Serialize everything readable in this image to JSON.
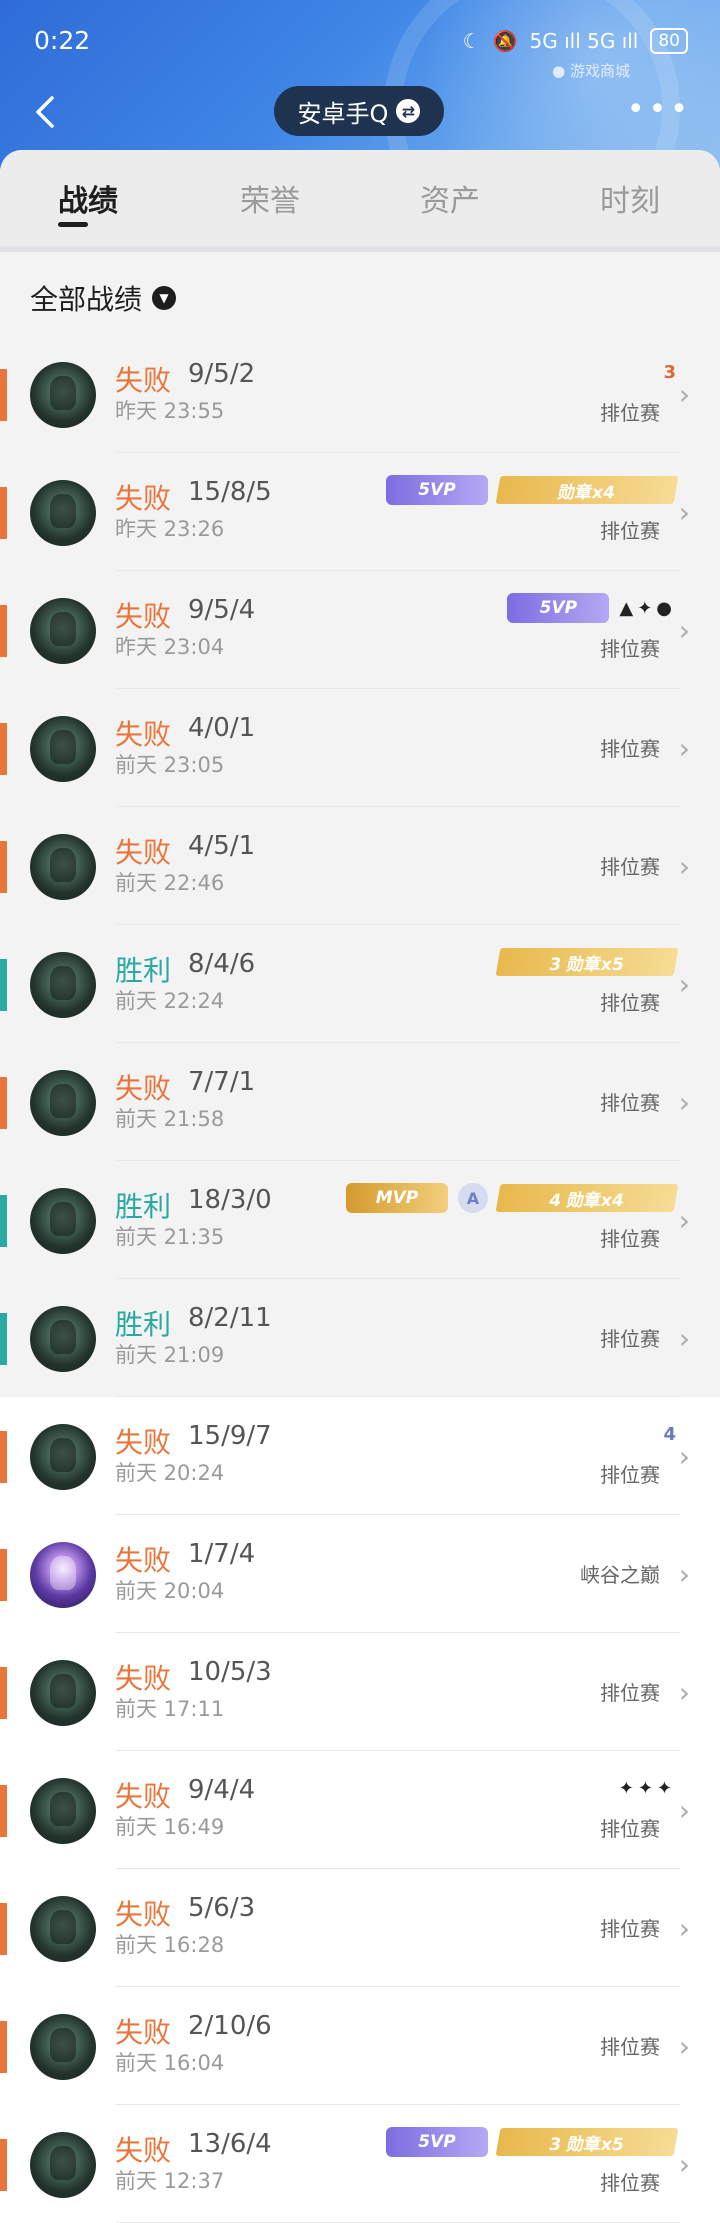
{
  "status_bar": {
    "time": "0:22",
    "signal_labels": "5G ıll 5G ıll",
    "battery": "80"
  },
  "header": {
    "account_name": "安卓手Q",
    "watermark": "● 游戏商城"
  },
  "tabs": [
    "战绩",
    "荣誉",
    "资产",
    "时刻"
  ],
  "filter_label": "全部战绩",
  "colors": {
    "loss": "#e8763a",
    "win": "#2aa9a2"
  },
  "matches": [
    {
      "result": "失败",
      "kda": "9/5/2",
      "time": "昨天 23:55",
      "mode": "排位赛",
      "outcome": "loss",
      "extra": "3",
      "avatar": "green"
    },
    {
      "result": "失败",
      "kda": "15/8/5",
      "time": "昨天 23:26",
      "mode": "排位赛",
      "outcome": "loss",
      "svp": "5VP",
      "medal": "勋章x4",
      "avatar": "green"
    },
    {
      "result": "失败",
      "kda": "9/5/4",
      "time": "昨天 23:04",
      "mode": "排位赛",
      "outcome": "loss",
      "svp": "5VP",
      "extra_icons": "▲✦●",
      "avatar": "green"
    },
    {
      "result": "失败",
      "kda": "4/0/1",
      "time": "前天 23:05",
      "mode": "排位赛",
      "outcome": "loss",
      "avatar": "green"
    },
    {
      "result": "失败",
      "kda": "4/5/1",
      "time": "前天 22:46",
      "mode": "排位赛",
      "outcome": "loss",
      "avatar": "green"
    },
    {
      "result": "胜利",
      "kda": "8/4/6",
      "time": "前天 22:24",
      "mode": "排位赛",
      "outcome": "win",
      "medal": "3 勋章x5",
      "avatar": "green"
    },
    {
      "result": "失败",
      "kda": "7/7/1",
      "time": "前天 21:58",
      "mode": "排位赛",
      "outcome": "loss",
      "avatar": "green"
    },
    {
      "result": "胜利",
      "kda": "18/3/0",
      "time": "前天 21:35",
      "mode": "排位赛",
      "outcome": "win",
      "mvp": "MVP",
      "a_icon": "A",
      "medal": "4 勋章x4",
      "avatar": "green"
    },
    {
      "result": "胜利",
      "kda": "8/2/11",
      "time": "前天 21:09",
      "mode": "排位赛",
      "outcome": "win",
      "avatar": "green"
    },
    {
      "result": "失败",
      "kda": "15/9/7",
      "time": "前天 20:24",
      "mode": "排位赛",
      "outcome": "loss",
      "extra": "4",
      "avatar": "green"
    },
    {
      "result": "失败",
      "kda": "1/7/4",
      "time": "前天 20:04",
      "mode": "峡谷之巅",
      "outcome": "loss",
      "avatar": "purple"
    },
    {
      "result": "失败",
      "kda": "10/5/3",
      "time": "前天 17:11",
      "mode": "排位赛",
      "outcome": "loss",
      "avatar": "green"
    },
    {
      "result": "失败",
      "kda": "9/4/4",
      "time": "前天 16:49",
      "mode": "排位赛",
      "outcome": "loss",
      "extra_icons": "✦✦✦",
      "avatar": "green"
    },
    {
      "result": "失败",
      "kda": "5/6/3",
      "time": "前天 16:28",
      "mode": "排位赛",
      "outcome": "loss",
      "avatar": "green"
    },
    {
      "result": "失败",
      "kda": "2/10/6",
      "time": "前天 16:04",
      "mode": "排位赛",
      "outcome": "loss",
      "avatar": "green"
    },
    {
      "result": "失败",
      "kda": "13/6/4",
      "time": "前天 12:37",
      "mode": "排位赛",
      "outcome": "loss",
      "svp": "5VP",
      "medal": "3 勋章x5",
      "avatar": "green"
    }
  ]
}
